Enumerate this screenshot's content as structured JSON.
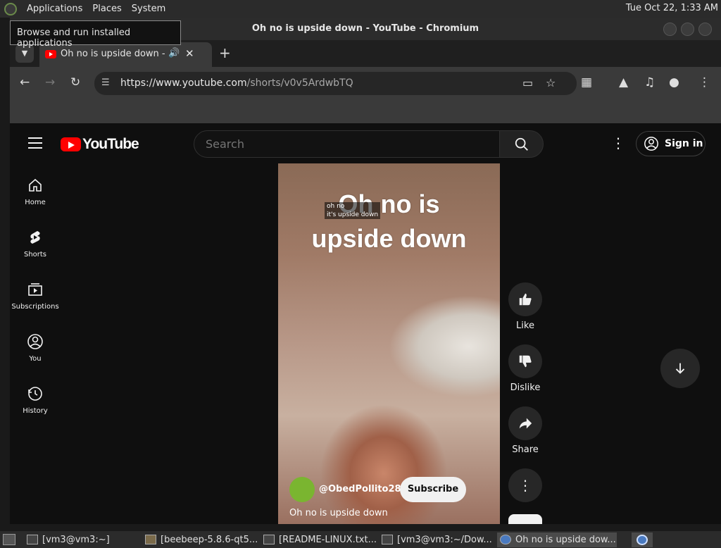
{
  "top_panel": {
    "menus": [
      "Applications",
      "Places",
      "System"
    ],
    "clock": "Tue Oct 22,  1:33 AM",
    "tooltip": "Browse and run installed applications"
  },
  "window": {
    "title": "Oh no is upside down - YouTube - Chromium"
  },
  "browser": {
    "tab_title": "Oh no is upside down - YouTube",
    "url_host": "https://www.youtube.com",
    "url_path": "/shorts/v0v5ArdwbTQ"
  },
  "youtube": {
    "logo": "YouTube",
    "search_placeholder": "Search",
    "sign_in": "Sign in",
    "sidebar": [
      {
        "label": "Home"
      },
      {
        "label": "Shorts"
      },
      {
        "label": "Subscriptions"
      },
      {
        "label": "You"
      },
      {
        "label": "History"
      }
    ],
    "video": {
      "caption_line1": "Oh no is",
      "caption_line2": "upside down",
      "subtitle_line1": "oh no",
      "subtitle_line2": "it's upside down",
      "channel": "@ObedPollito285",
      "subscribe": "Subscribe",
      "title": "Oh no is upside down"
    },
    "actions": {
      "like": "Like",
      "dislike": "Dislike",
      "share": "Share"
    }
  },
  "taskbar": {
    "items": [
      {
        "label": "[vm3@vm3:~]"
      },
      {
        "label": "[beebeep-5.8.6-qt5..."
      },
      {
        "label": "[README-LINUX.txt..."
      },
      {
        "label": "[vm3@vm3:~/Dow..."
      },
      {
        "label": "Oh no is upside dow..."
      }
    ]
  }
}
